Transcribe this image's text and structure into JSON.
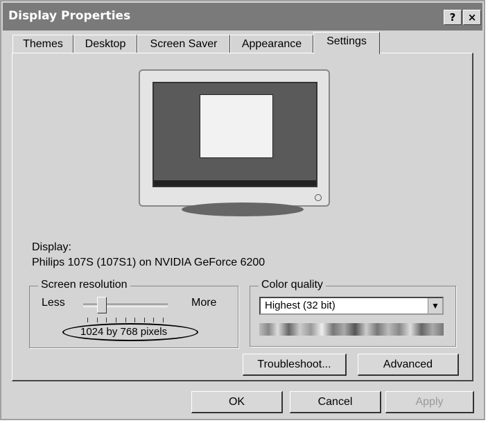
{
  "window": {
    "title": "Display Properties",
    "help_button": "?",
    "close_button": "×"
  },
  "tabs": [
    {
      "label": "Themes"
    },
    {
      "label": "Desktop"
    },
    {
      "label": "Screen Saver"
    },
    {
      "label": "Appearance"
    },
    {
      "label": "Settings",
      "active": true
    }
  ],
  "display": {
    "label": "Display:",
    "device": "Philips 107S (107S1) on NVIDIA GeForce 6200"
  },
  "screen_resolution": {
    "title": "Screen resolution",
    "less_label": "Less",
    "more_label": "More",
    "value": "1024 by 768 pixels",
    "slider_fraction": 0.22
  },
  "color_quality": {
    "title": "Color quality",
    "selected": "Highest (32 bit)"
  },
  "buttons": {
    "troubleshoot": "Troubleshoot...",
    "advanced": "Advanced",
    "ok": "OK",
    "cancel": "Cancel",
    "apply": "Apply"
  }
}
